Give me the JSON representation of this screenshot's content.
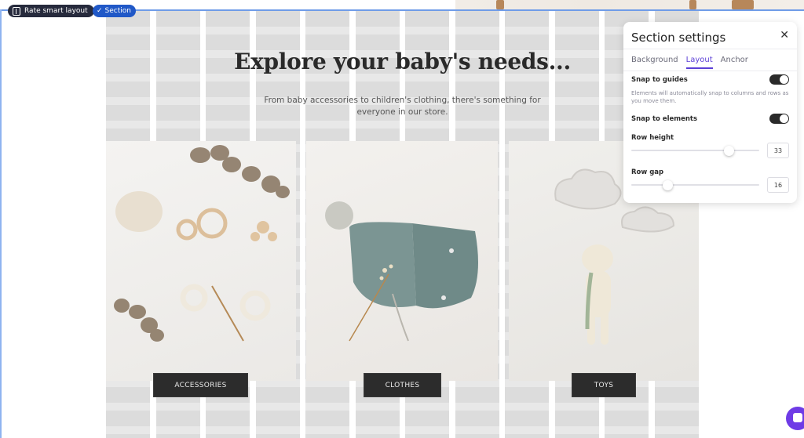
{
  "toolbar": {
    "rate_label": "Rate smart layout",
    "section_label": "Section",
    "rate_icon": "layout-icon",
    "section_icon": "check-icon",
    "section_check": "✓"
  },
  "content": {
    "heading": "Explore your baby's needs...",
    "subtext": "From baby accessories to children's clothing, there's something for everyone in our store."
  },
  "categories": [
    {
      "label": "ACCESSORIES",
      "image": "knitting-accessories-photo"
    },
    {
      "label": "CLOTHES",
      "image": "knit-baby-bonnet-photo"
    },
    {
      "label": "TOYS",
      "image": "crochet-bear-and-clouds-photo"
    }
  ],
  "panel": {
    "title": "Section settings",
    "close": "✕",
    "tabs": [
      {
        "label": "Background",
        "active": false
      },
      {
        "label": "Layout",
        "active": true
      },
      {
        "label": "Anchor",
        "active": false
      }
    ],
    "snap_guides": {
      "label": "Snap to guides",
      "enabled": true,
      "hint": "Elements will automatically snap to columns and rows as you move them."
    },
    "snap_elements": {
      "label": "Snap to elements",
      "enabled": true
    },
    "row_height": {
      "label": "Row height",
      "value": "33",
      "slider_fraction": 0.76
    },
    "row_gap": {
      "label": "Row gap",
      "value": "16",
      "slider_fraction": 0.28
    }
  },
  "colors": {
    "accent": "#5b3fd6",
    "section_blue": "#2058c7",
    "outline_blue": "#6f9ce8",
    "chat": "#6e3be6"
  }
}
